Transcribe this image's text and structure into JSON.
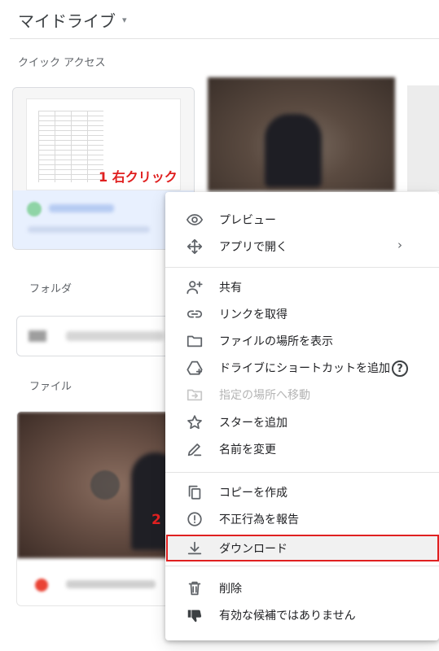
{
  "header": {
    "title": "マイドライブ",
    "caret": "▾"
  },
  "sections": {
    "quick_access": "クイック アクセス",
    "folders": "フォルダ",
    "files": "ファイル"
  },
  "annotations": {
    "step1": "1 右クリック",
    "step2": "2"
  },
  "context_menu": {
    "items": [
      {
        "label": "プレビュー",
        "icon": "eye-icon"
      },
      {
        "label": "アプリで開く",
        "icon": "move-arrows-icon",
        "submenu_indicator": "›"
      },
      {
        "label": "共有",
        "icon": "person-add-icon"
      },
      {
        "label": "リンクを取得",
        "icon": "link-icon"
      },
      {
        "label": "ファイルの場所を表示",
        "icon": "folder-icon"
      },
      {
        "label": "ドライブにショートカットを追加",
        "icon": "drive-shortcut-icon",
        "help": "?"
      },
      {
        "label": "指定の場所へ移動",
        "icon": "move-to-folder-icon",
        "disabled": true
      },
      {
        "label": "スターを追加",
        "icon": "star-icon"
      },
      {
        "label": "名前を変更",
        "icon": "pencil-icon"
      },
      {
        "label": "コピーを作成",
        "icon": "copy-icon"
      },
      {
        "label": "不正行為を報告",
        "icon": "report-icon"
      },
      {
        "label": "ダウンロード",
        "icon": "download-icon",
        "highlighted": true
      },
      {
        "label": "削除",
        "icon": "trash-icon"
      },
      {
        "label": "有効な候補ではありません",
        "icon": "thumb-down-icon"
      }
    ]
  },
  "colors": {
    "annotation": "#e02020",
    "selected_card": "#e8f0fe",
    "icon": "#5f6368"
  }
}
